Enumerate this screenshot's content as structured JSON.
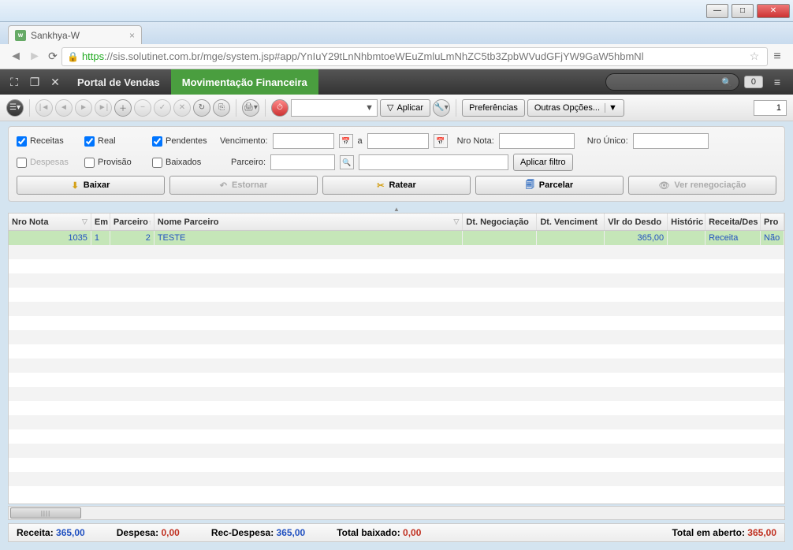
{
  "window": {
    "title": "Sankhya-W"
  },
  "browser": {
    "url_https": "https",
    "url_rest": "://sis.solutinet.com.br/mge/system.jsp#app/YnIuY29tLnNhbmtoeWEuZmluLmNhZC5tb3ZpbWVudGFjYW9GaW5hbmNl"
  },
  "app": {
    "tab1": "Portal de Vendas",
    "tab2": "Movimentação Financeira",
    "notif_count": "0"
  },
  "toolbar": {
    "aplicar": "Aplicar",
    "preferencias": "Preferências",
    "outras": "Outras Opções...",
    "page": "1"
  },
  "filters": {
    "receitas": "Receitas",
    "real": "Real",
    "pendentes": "Pendentes",
    "despesas": "Despesas",
    "provisao": "Provisão",
    "baixados": "Baixados",
    "vencimento": "Vencimento:",
    "a": "a",
    "nro_nota": "Nro Nota:",
    "nro_unico": "Nro Único:",
    "parceiro": "Parceiro:",
    "aplicar_filtro": "Aplicar filtro",
    "baixar": "Baixar",
    "estornar": "Estornar",
    "ratear": "Ratear",
    "parcelar": "Parcelar",
    "ver_reneg": "Ver renegociação"
  },
  "columns": {
    "nro_nota": "Nro Nota",
    "em": "Em",
    "parceiro": "Parceiro",
    "nome_parceiro": "Nome Parceiro",
    "dt_neg": "Dt. Negociação",
    "dt_venc": "Dt. Venciment",
    "vlr": "Vlr do Desdo",
    "hist": "Históric",
    "rec_desp": "Receita/Des",
    "pro": "Pro"
  },
  "rows": [
    {
      "nro": "1035",
      "em": "1",
      "parc": "2",
      "nome": "TESTE",
      "neg": "",
      "venc": "",
      "vlr": "365,00",
      "hist": "",
      "rec": "Receita",
      "pro": "Não"
    }
  ],
  "status": {
    "receita_lbl": "Receita:",
    "receita_val": "365,00",
    "despesa_lbl": "Despesa:",
    "despesa_val": "0,00",
    "recdesp_lbl": "Rec-Despesa:",
    "recdesp_val": "365,00",
    "baixado_lbl": "Total baixado:",
    "baixado_val": "0,00",
    "aberto_lbl": "Total em aberto:",
    "aberto_val": "365,00"
  }
}
